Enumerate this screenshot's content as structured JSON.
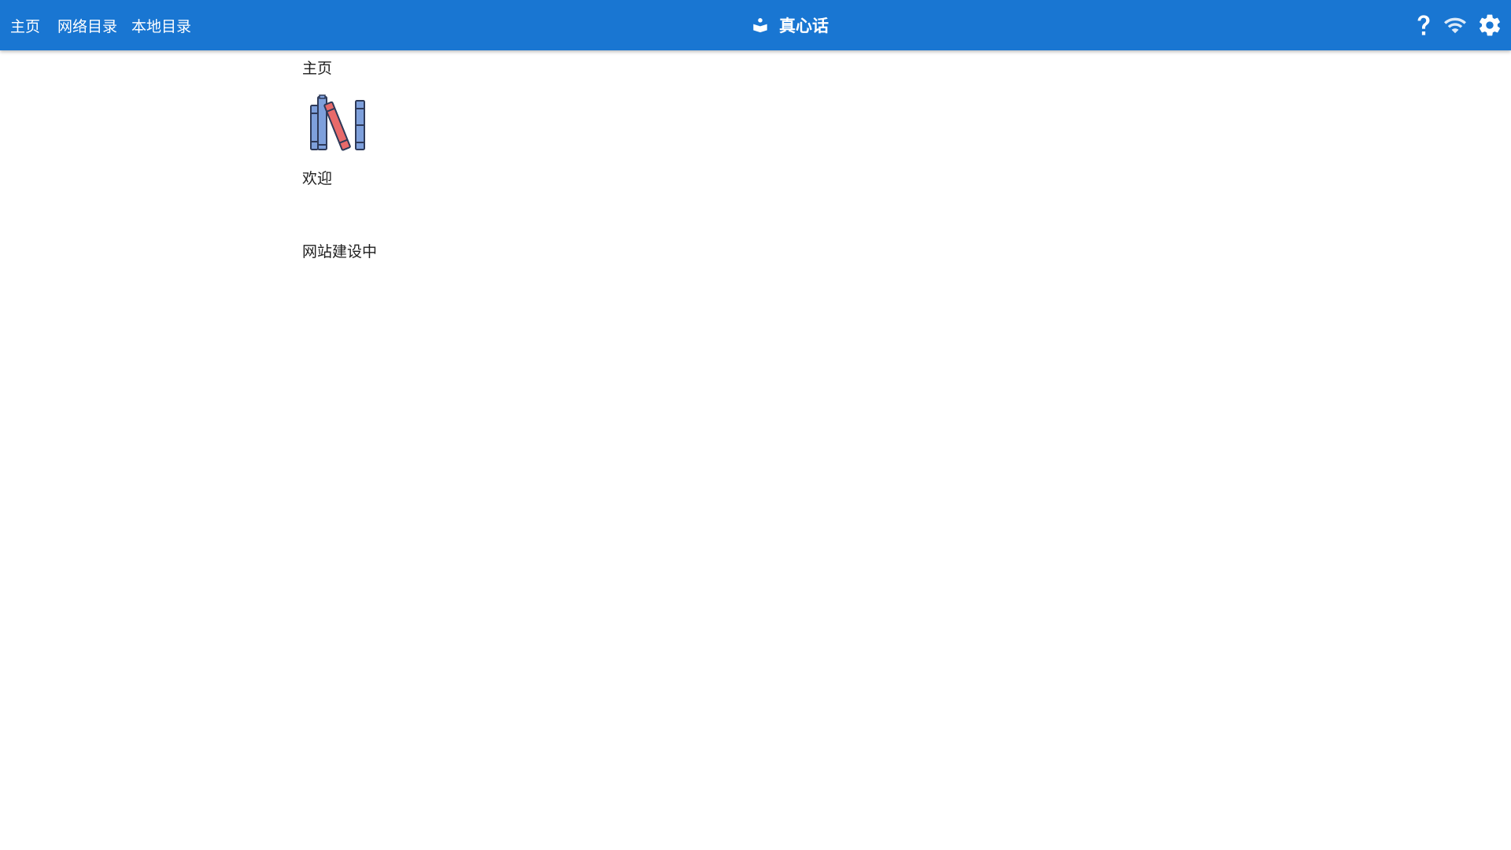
{
  "nav": {
    "links": [
      {
        "label": "主页"
      },
      {
        "label": "网络目录"
      },
      {
        "label": "本地目录"
      }
    ]
  },
  "brand": {
    "title": "真心话",
    "icon": "book-reader-icon"
  },
  "actions": {
    "icons": [
      "help-icon",
      "wifi-icon",
      "settings-icon"
    ]
  },
  "main": {
    "breadcrumb": "主页",
    "illustration": "books-icon",
    "welcome": "欢迎",
    "notice": "网站建设中"
  },
  "colors": {
    "appbar": "#1976d2",
    "book_blue": "#7ea0dc",
    "book_red": "#e86a6a",
    "book_outline": "#2e3a59"
  }
}
